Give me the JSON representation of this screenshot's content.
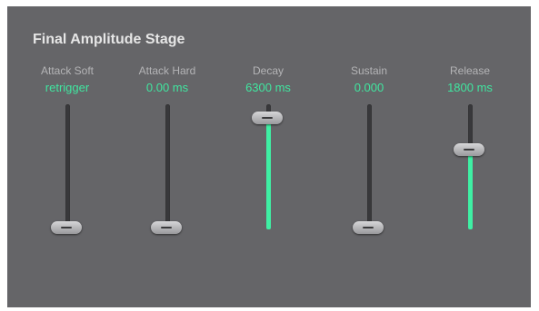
{
  "panel": {
    "title": "Final Amplitude Stage"
  },
  "sliders": [
    {
      "label": "Attack Soft",
      "value": "retrigger",
      "level": 0.0
    },
    {
      "label": "Attack Hard",
      "value": "0.00 ms",
      "level": 0.0
    },
    {
      "label": "Decay",
      "value": "6300 ms",
      "level": 0.94
    },
    {
      "label": "Sustain",
      "value": "0.000",
      "level": 0.0
    },
    {
      "label": "Release",
      "value": "1800 ms",
      "level": 0.67
    }
  ],
  "colors": {
    "background": "#656568",
    "accent": "#3ff0a4",
    "label": "#b4b4b6",
    "title": "#e6e6e6"
  }
}
